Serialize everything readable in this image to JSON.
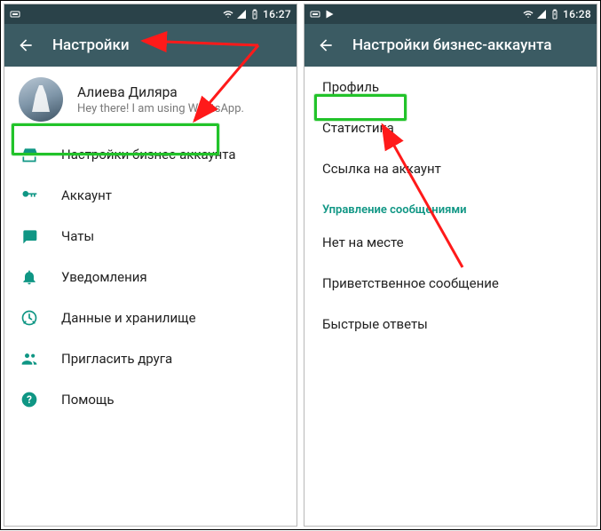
{
  "left": {
    "statusbar": {
      "time": "16:27"
    },
    "appbar": {
      "title": "Настройки"
    },
    "profile": {
      "name": "Алиева Диляра",
      "status": "Hey there! I am using WhatsApp."
    },
    "items": [
      {
        "icon": "storefront",
        "label": "Настройки бизнес-аккаунта"
      },
      {
        "icon": "key",
        "label": "Аккаунт"
      },
      {
        "icon": "chat",
        "label": "Чаты"
      },
      {
        "icon": "bell",
        "label": "Уведомления"
      },
      {
        "icon": "data",
        "label": "Данные и хранилище"
      },
      {
        "icon": "people",
        "label": "Пригласить друга"
      },
      {
        "icon": "help",
        "label": "Помощь"
      }
    ]
  },
  "right": {
    "statusbar": {
      "time": "16:28"
    },
    "appbar": {
      "title": "Настройки бизнес-аккаунта"
    },
    "items_top": [
      "Профиль",
      "Статистика",
      "Ссылка на аккаунт"
    ],
    "section_header": "Управление сообщениями",
    "items_bottom": [
      "Нет на месте",
      "Приветственное сообщение",
      "Быстрые ответы"
    ]
  },
  "annotation": {
    "highlight_left": "Настройки бизнес-аккаунта",
    "highlight_right": "Статистика"
  }
}
